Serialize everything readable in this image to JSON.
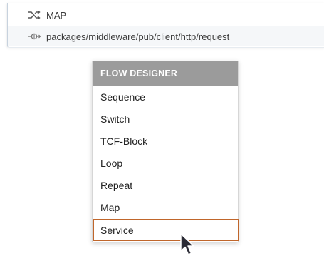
{
  "flow_panel": {
    "rows": [
      {
        "icon": "shuffle-icon",
        "label": "MAP"
      },
      {
        "icon": "service-node-icon",
        "label": "packages/middleware/pub/client/http/request"
      }
    ]
  },
  "menu": {
    "header": "FLOW DESIGNER",
    "items": [
      {
        "label": "Sequence"
      },
      {
        "label": "Switch"
      },
      {
        "label": "TCF-Block"
      },
      {
        "label": "Loop"
      },
      {
        "label": "Repeat"
      },
      {
        "label": "Map"
      },
      {
        "label": "Service"
      }
    ],
    "highlighted_item": "Service",
    "highlight_color": "#c0662b"
  },
  "colors": {
    "menu_header_bg": "#9b9b9b",
    "menu_header_text": "#ffffff",
    "panel_border": "#c7d2de"
  }
}
